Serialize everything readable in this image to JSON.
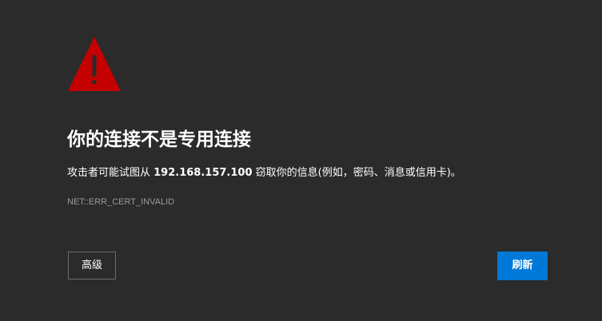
{
  "warning": {
    "icon": "warning-triangle-icon",
    "color": "#c40000"
  },
  "title": "你的连接不是专用连接",
  "description": {
    "before": "攻击者可能试图从 ",
    "host": "192.168.157.100",
    "after": " 窃取你的信息(例如，密码、消息或信用卡)。"
  },
  "error_code": "NET::ERR_CERT_INVALID",
  "buttons": {
    "advanced_label": "高级",
    "refresh_label": "刷新"
  },
  "colors": {
    "background": "#2b2b2b",
    "primary_button": "#0078d7"
  }
}
